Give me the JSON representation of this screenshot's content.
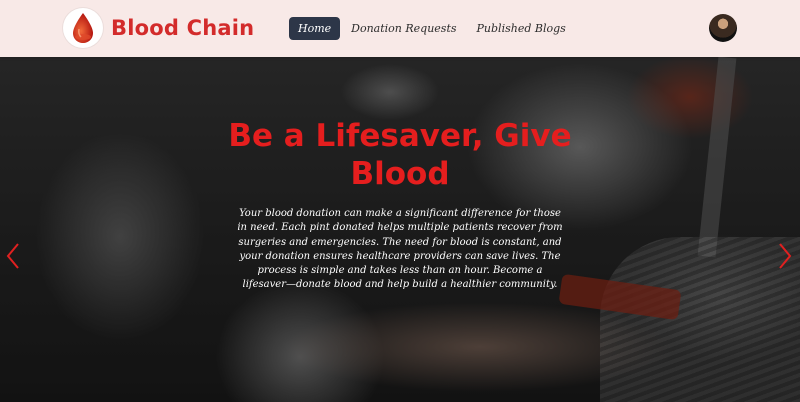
{
  "navbar": {
    "brand_name": "Blood Chain",
    "links": [
      {
        "label": "Home",
        "active": true
      },
      {
        "label": "Donation Requests",
        "active": false
      },
      {
        "label": "Published Blogs",
        "active": false
      }
    ],
    "avatar_icon": "user-avatar"
  },
  "hero": {
    "title": "Be a Lifesaver, Give Blood",
    "text": "Your blood donation can make a significant difference for those in need. Each pint donated helps multiple patients recover from surgeries and emergencies. The need for blood is constant, and your donation ensures healthcare providers can save lives. The process is simple and takes less than an hour. Become a lifesaver—donate blood and help build a healthier community.",
    "prev_icon": "chevron-left-icon",
    "next_icon": "chevron-right-icon"
  },
  "colors": {
    "brand_red": "#d32b2b",
    "title_red": "#e51e1e",
    "nav_bg": "#f8e9e7",
    "active_tab": "#2d3648"
  }
}
